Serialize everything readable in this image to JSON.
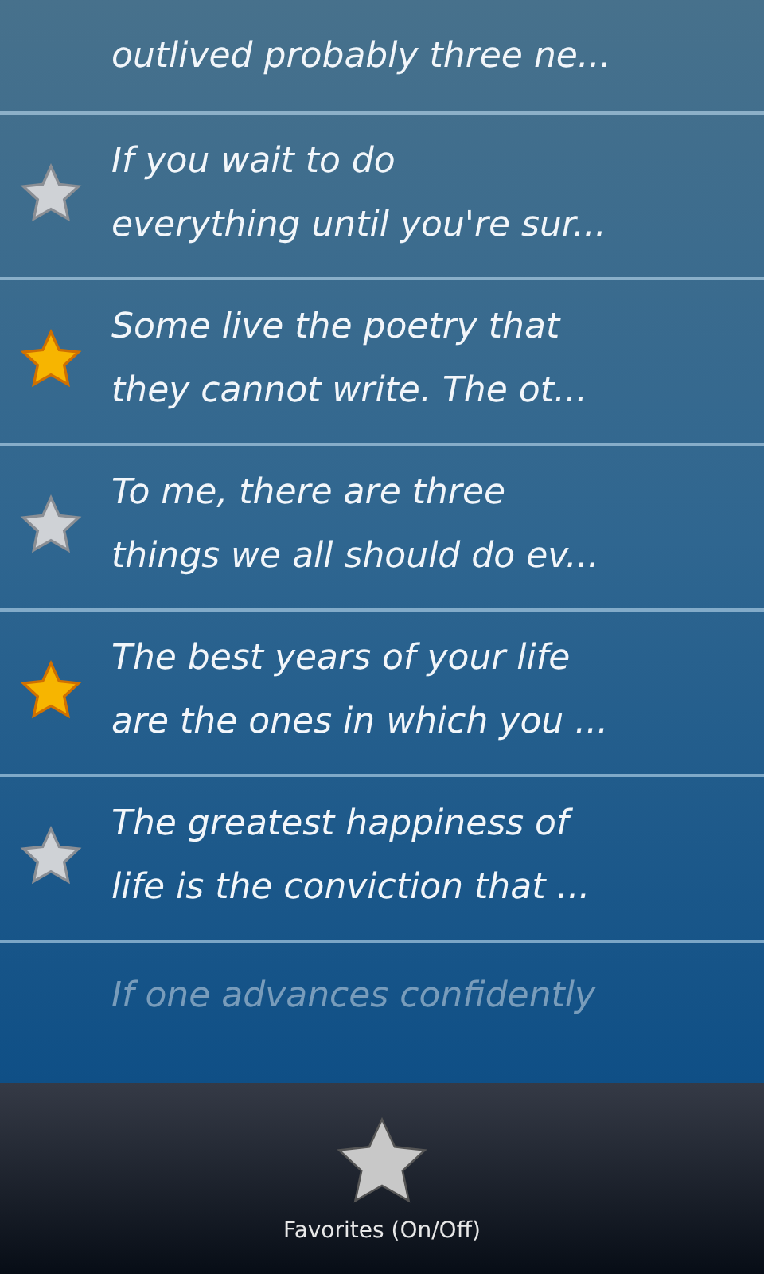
{
  "quotes": [
    {
      "lines": [
        "outlived probably three ne..."
      ],
      "kind": "cut-top"
    },
    {
      "lines": [
        "If you wait to do",
        "everything until you're sur..."
      ],
      "starred": false,
      "kind": "full"
    },
    {
      "lines": [
        "Some live the poetry that",
        "they cannot write. The ot..."
      ],
      "starred": true,
      "kind": "full"
    },
    {
      "lines": [
        "To me, there are three",
        "things we all should do ev..."
      ],
      "starred": false,
      "kind": "full"
    },
    {
      "lines": [
        "The best years of your life",
        "are the ones in which you ..."
      ],
      "starred": true,
      "kind": "full"
    },
    {
      "lines": [
        "The greatest happiness of",
        "life is the conviction that ..."
      ],
      "starred": false,
      "kind": "full"
    },
    {
      "lines": [
        "If one advances confidently"
      ],
      "kind": "cut-bottom"
    }
  ],
  "bottom_bar": {
    "label": "Favorites (On/Off)"
  }
}
